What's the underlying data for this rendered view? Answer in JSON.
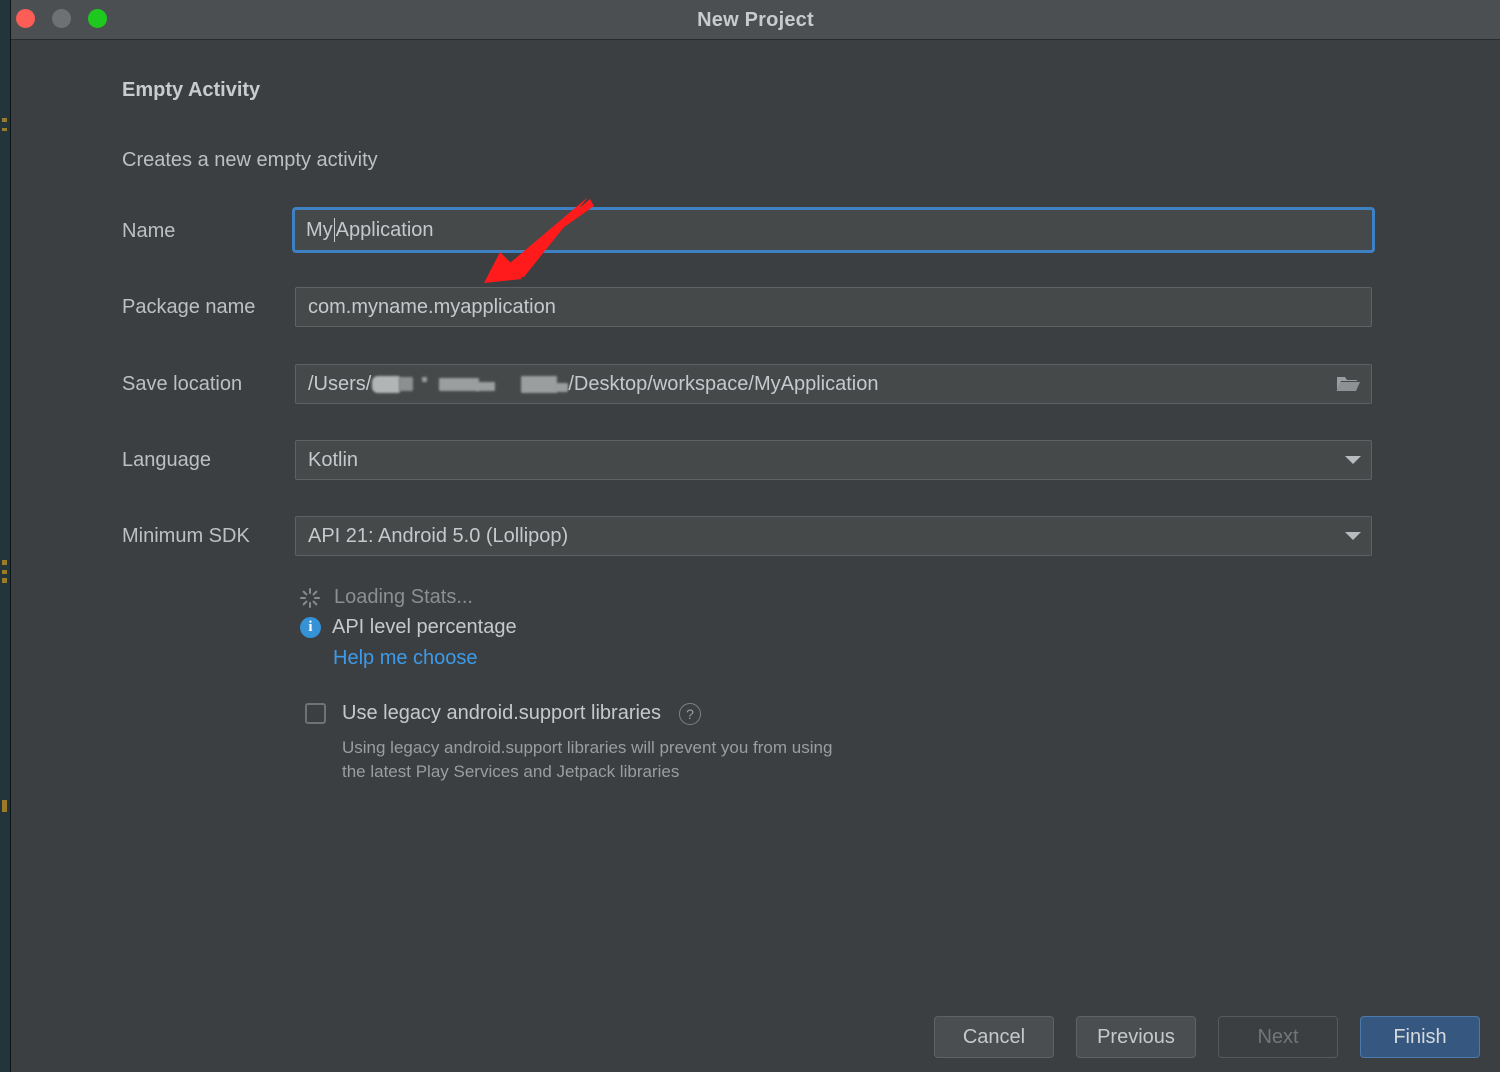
{
  "window": {
    "title": "New Project",
    "traffic_lights": [
      "close-red",
      "minimize-gray",
      "zoom-green"
    ]
  },
  "dialog": {
    "heading": "Empty Activity",
    "subheading": "Creates a new empty activity"
  },
  "fields": {
    "name": {
      "label": "Name",
      "value_before_caret": "My ",
      "value_after_caret": "Application",
      "full_value": "My Application",
      "focused": true
    },
    "package_name": {
      "label": "Package name",
      "value": "com.myname.myapplication"
    },
    "save_location": {
      "label": "Save location",
      "prefix": "/Users/",
      "suffix": "/Desktop/workspace/MyApplication",
      "redacted": true,
      "browse_icon": "folder-icon"
    },
    "language": {
      "label": "Language",
      "value": "Kotlin",
      "dropdown_icon": "chevron-down-icon"
    },
    "minimum_sdk": {
      "label": "Minimum SDK",
      "value": "API 21: Android 5.0 (Lollipop)",
      "dropdown_icon": "chevron-down-icon"
    }
  },
  "stats": {
    "loading_text": "Loading Stats...",
    "api_level_text": "API level percentage",
    "help_link": "Help me choose",
    "spinner_icon": "loading-spinner-icon",
    "info_icon": "info-icon"
  },
  "legacy": {
    "checkbox_label": "Use legacy android.support libraries",
    "checked": false,
    "help_icon": "question-mark-icon",
    "hint_line1": "Using legacy android.support libraries will prevent you from using",
    "hint_line2": "the latest Play Services and Jetpack libraries"
  },
  "footer": {
    "cancel": "Cancel",
    "previous": "Previous",
    "next": "Next",
    "next_disabled": true,
    "finish": "Finish"
  },
  "annotation": {
    "arrow_color": "#ff1b1b",
    "points_to": "name-input"
  },
  "colors": {
    "window_bg": "#3c3f41",
    "titlebar_bg": "#4b4f51",
    "field_bg": "#45494a",
    "focus_border": "#3d81c4",
    "link_blue": "#3d9ae8",
    "primary_button": "#365880",
    "info_blue": "#3592d6"
  }
}
